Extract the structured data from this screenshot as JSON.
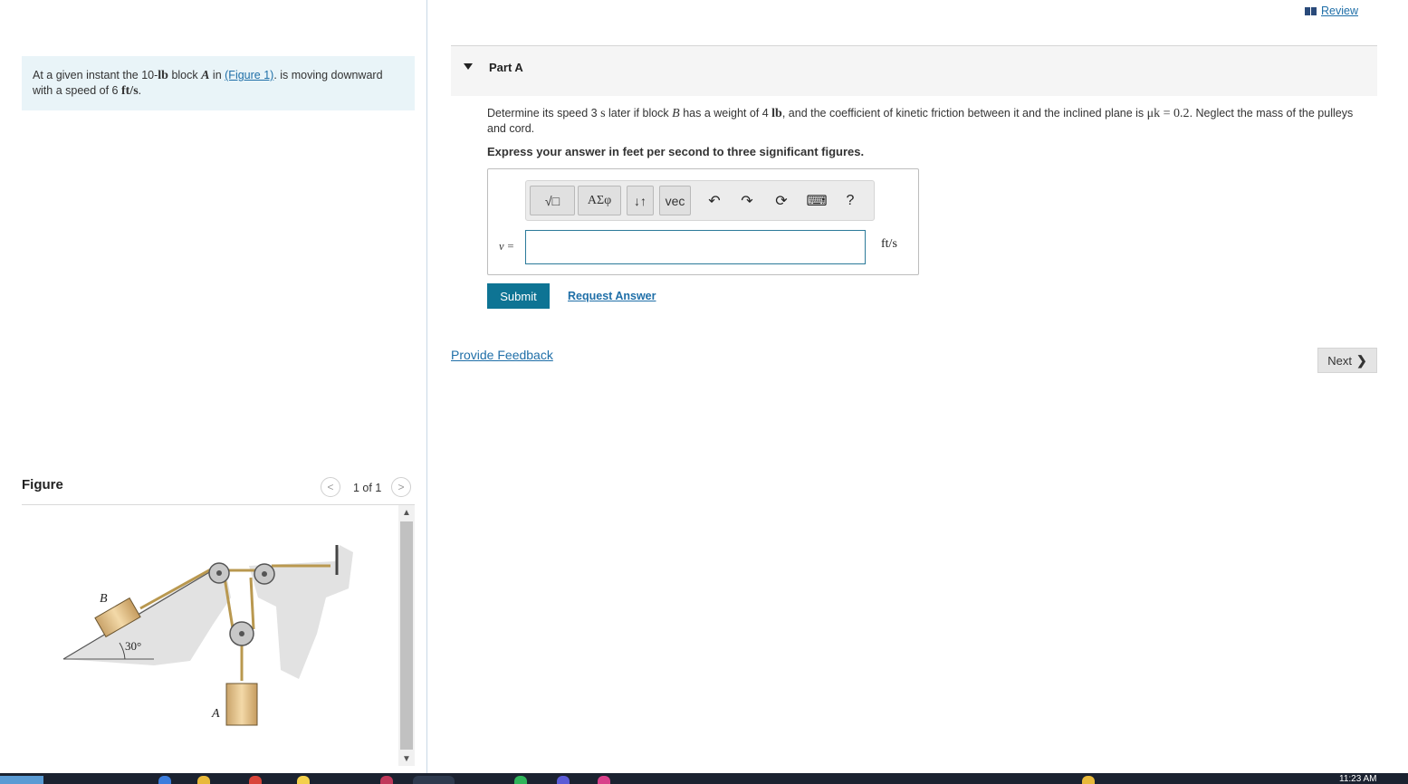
{
  "header": {
    "review_label": "Review"
  },
  "intro": {
    "text_1": "At a given instant the 10-",
    "unit_lb": "lb",
    "text_2": " block ",
    "block_a": "A",
    "text_3": " in ",
    "figure_link": "(Figure 1)",
    "text_4": ". is moving downward",
    "text_5": "with a speed of 6 ",
    "speed_unit": "ft/s",
    "text_6": "."
  },
  "figure_panel": {
    "title": "Figure",
    "pager_text": "1 of 1",
    "labels": {
      "block_b": "B",
      "block_a": "A",
      "angle": "30°"
    }
  },
  "part": {
    "title": "Part A",
    "q_1": "Determine its speed 3 ",
    "q_s": "s",
    "q_2": " later if block ",
    "q_b": "B",
    "q_3": " has a weight of 4 ",
    "q_lb": "lb",
    "q_4": ", and the coefficient of kinetic friction between it and the inclined plane is ",
    "q_mu": "μk = 0.2",
    "q_5": ". Neglect the mass of the pulleys and cord.",
    "instruction": "Express your answer in feet per second to three significant figures."
  },
  "answer": {
    "toolbar": {
      "templates_label": "√□",
      "greek_label": "ΑΣφ",
      "arrows_label": "↓↑",
      "vec_label": "vec",
      "undo_icon": "↶",
      "redo_icon": "↷",
      "reset_icon": "⟳",
      "keyboard_icon": "⌨",
      "help_label": "?"
    },
    "variable_label": "v =",
    "input_value": "",
    "unit": "ft/s"
  },
  "actions": {
    "submit_label": "Submit",
    "request_answer_label": "Request Answer",
    "feedback_label": "Provide Feedback",
    "next_label": "Next",
    "next_icon": "❯"
  },
  "taskbar": {
    "clock": "11:23 AM"
  },
  "colors": {
    "accent": "#0e7494",
    "link": "#1f6fa8",
    "intro_bg": "#e9f4f8",
    "part_bar_bg": "#f5f5f5"
  }
}
